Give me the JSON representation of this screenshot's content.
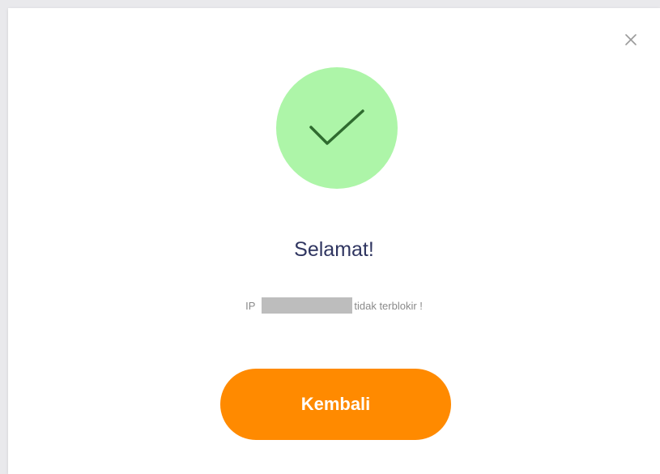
{
  "dialog": {
    "close_icon": "close-icon",
    "status_icon": "checkmark-icon",
    "title": "Selamat!",
    "message_prefix": "IP",
    "message_suffix": "tidak terblokir !",
    "button_label": "Kembali"
  },
  "colors": {
    "success_circle": "#adf5a8",
    "checkmark": "#2f6b2f",
    "title": "#2f3560",
    "button": "#ff8a00",
    "close": "#9a9a9a"
  }
}
